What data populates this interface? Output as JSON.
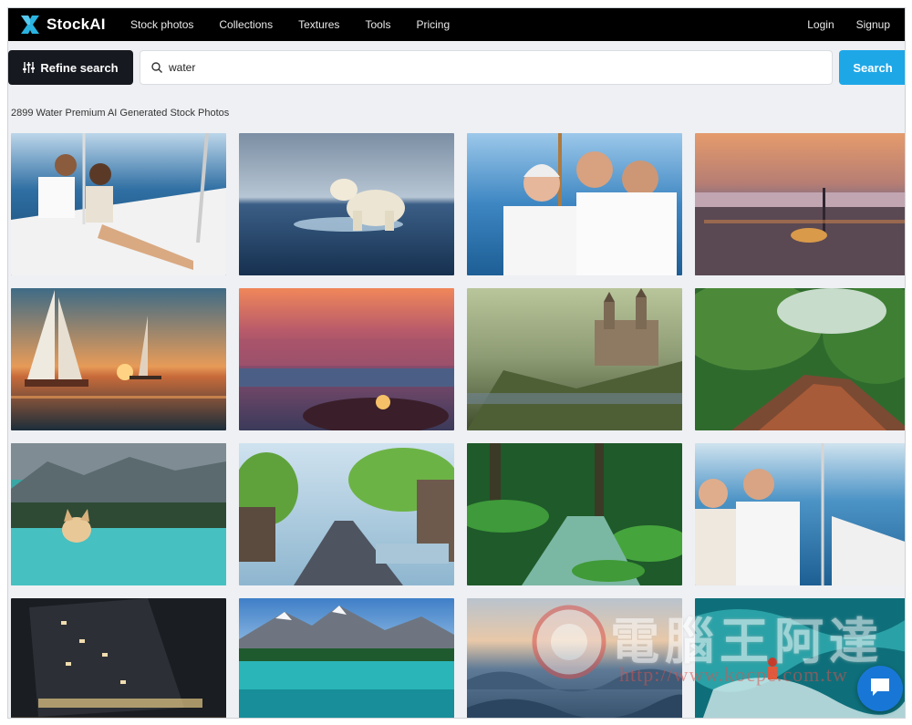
{
  "brand": {
    "name": "StockAI",
    "logo_icon": "stockai-logo-icon",
    "accent": "#1ea7e7"
  },
  "nav": {
    "items": [
      {
        "label": "Stock photos"
      },
      {
        "label": "Collections"
      },
      {
        "label": "Textures"
      },
      {
        "label": "Tools"
      },
      {
        "label": "Pricing"
      }
    ],
    "login": "Login",
    "signup": "Signup"
  },
  "search": {
    "refine_label": "Refine search",
    "query": "water",
    "button_label": "Search"
  },
  "results": {
    "count_text": "2899 Water Premium AI Generated Stock Photos"
  },
  "images": [
    {
      "subject": "couple-on-sailboat"
    },
    {
      "subject": "polar-bear-in-water"
    },
    {
      "subject": "elderly-couple-on-boat"
    },
    {
      "subject": "city-skyline-sunset"
    },
    {
      "subject": "sailboats-at-sunset"
    },
    {
      "subject": "coastal-city-dusk"
    },
    {
      "subject": "castle-on-hill"
    },
    {
      "subject": "jungle-river"
    },
    {
      "subject": "dog-swimming-lake"
    },
    {
      "subject": "canal-city-trees"
    },
    {
      "subject": "mossy-forest-stream"
    },
    {
      "subject": "elderly-couple-yacht"
    },
    {
      "subject": "office-building-night"
    },
    {
      "subject": "mountain-turquoise-lake"
    },
    {
      "subject": "misty-sea-waves"
    },
    {
      "subject": "surfer-big-wave"
    }
  ],
  "watermark": {
    "text_cjk": "電腦王阿達",
    "url": "http://www.kocpc.com.tw"
  },
  "chat": {
    "icon": "chat-bubble-icon"
  }
}
